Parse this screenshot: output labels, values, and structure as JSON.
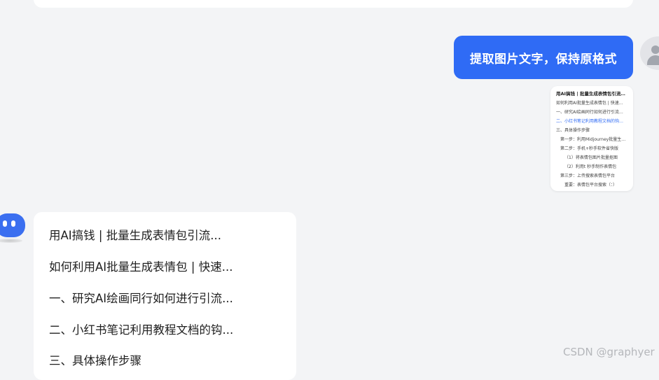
{
  "user_message": {
    "text": "提取图片文字，保持原格式",
    "image_lines": [
      "用AI搞钱 | 批量生成表情包引流…",
      "如何利用AI批量生成表情包 | 快速…",
      "一、研究AI绘画同行如何进行引流…",
      "二、小红书笔记利用教程文档的钩…",
      "三、具体操作步骤",
      "第一步：利用Midjourney批量生…",
      "第二步：手机+秒手软件省快版",
      "（1）将表情包图片批量抠图",
      "（2）利用t 秒手制作表情包",
      "第三步：上传搜索表情包平台",
      "重要：表情包平台搜索（：）"
    ]
  },
  "bot_message": {
    "lines": [
      "用AI搞钱 | 批量生成表情包引流...",
      "如何利用AI批量生成表情包 | 快速...",
      "一、研究AI绘画同行如何进行引流...",
      "二、小红书笔记利用教程文档的钩...",
      "三、具体操作步骤"
    ]
  },
  "watermark": "CSDN @graphyer",
  "colors": {
    "background": "#f3f4f6",
    "user_bubble": "#2f6bf5",
    "bot_avatar": "#3b6ff0",
    "card": "#ffffff"
  },
  "icons": {
    "user_avatar": "user-silhouette-icon",
    "bot_avatar": "robot-face-icon"
  }
}
